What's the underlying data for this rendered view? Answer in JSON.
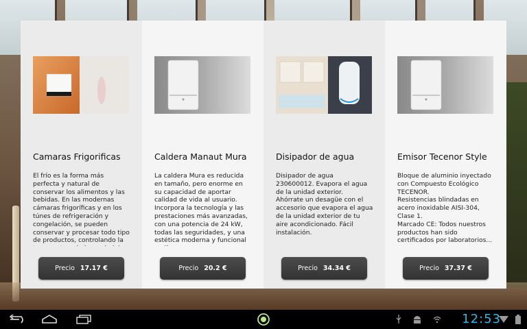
{
  "products": [
    {
      "title": "Camaras Frigorificas",
      "description": "El frío es la forma más perfecta y natural de conservar los alimentos y las bebidas. En las modernas cámaras frigoríficas y en los túnes de refrigeración y congelación, se pueden conservar y procesar todo tipo de productos, controlando la temperatura, la humedad, la...",
      "price_label": "Precio",
      "price": "17.17 €",
      "image_icon": "wall-heater-image"
    },
    {
      "title": "Caldera Manaut Mura",
      "description": "La caldera Mura es reducida en tamaño, pero enorme en su capacidad de aportar calidad de vida al usuario. Incorpora la tecnología y las prestaciones más avanzadas, con una potencia de 24 kW, todas las seguridades, y una estética moderna y funcional en línea...",
      "price_label": "Precio",
      "price": "20.2 €",
      "image_icon": "boiler-image"
    },
    {
      "title": "Disipador de agua",
      "description": "Disipador de agua 230600012. Evapora el agua de la unidad exterior.\n Ahórrate un desagüe con el accesorio que evapora el agua de la unidad exterior de tu aire acondicionado. Fácil instalación.",
      "price_label": "Precio",
      "price": "34.34 €",
      "image_icon": "water-heater-image"
    },
    {
      "title": "Emisor Tecenor Style",
      "description": "Bloque de aluminio inyectado con Compuesto Ecológico TECENOR.\nResistencias blindadas en acero inoxidable AISI-304, Clase 1.\nMarcado CE: Todos nuestros productos han sido certificados por laboratorios...",
      "price_label": "Precio",
      "price": "37.37 €",
      "image_icon": "boiler-image"
    }
  ],
  "status_bar": {
    "time": "12:53"
  },
  "colors": {
    "clock": "#33b5e5",
    "button_bg": "#3a3a3a",
    "home_indicator": "#b8e986"
  }
}
